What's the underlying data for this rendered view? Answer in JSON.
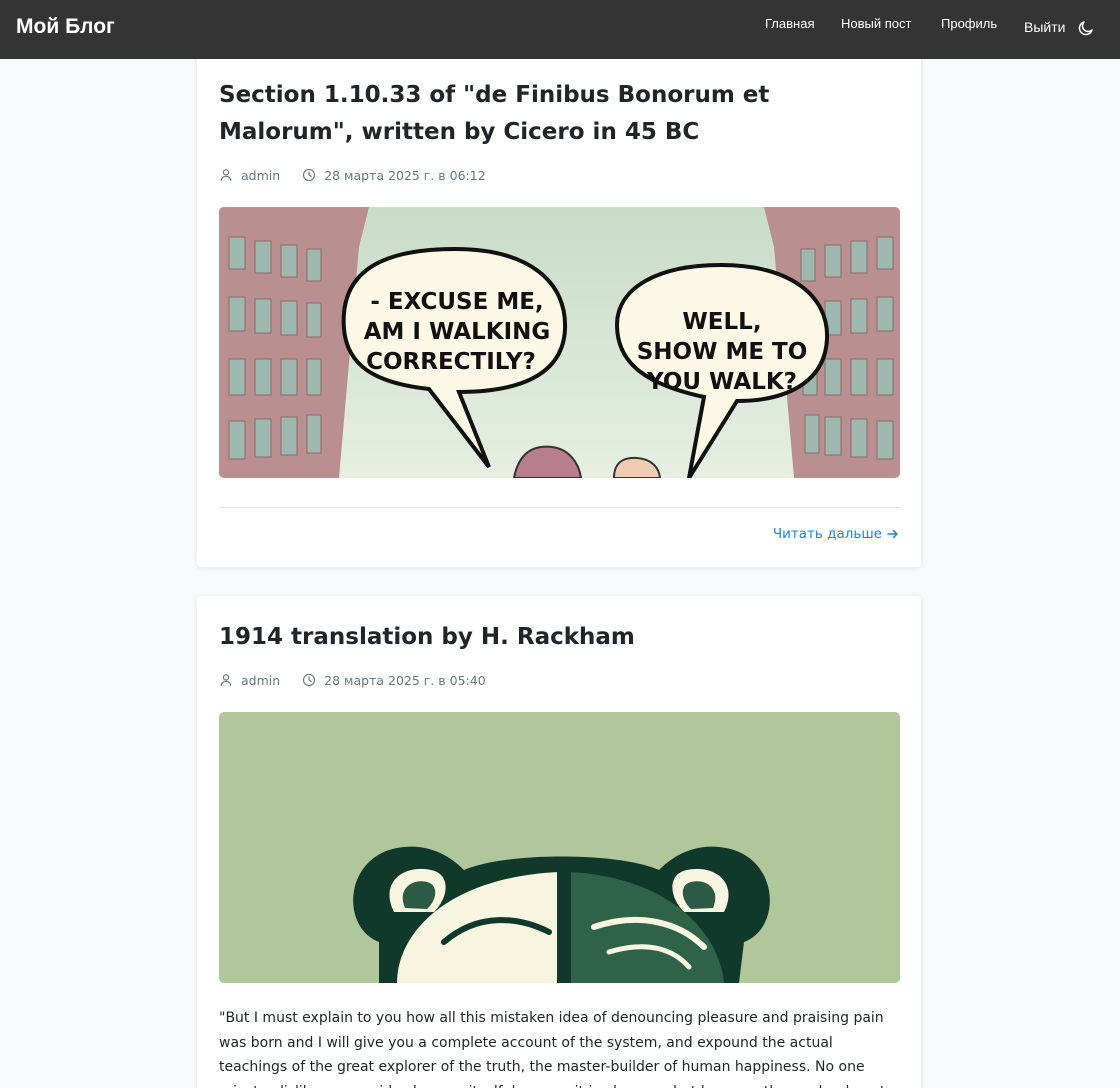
{
  "navbar": {
    "brand": "Мой Блог",
    "links": [
      "Главная",
      "Новый пост",
      "Профиль"
    ],
    "logout": "Выйти",
    "theme_icon": "moon-icon"
  },
  "posts": [
    {
      "title": "Section 1.10.33 of \"de Finibus Bonorum et Malorum\", written by Cicero in 45 BC",
      "author": "admin",
      "date": "28 марта 2025 г. в 06:12",
      "image": {
        "bubble_left": [
          "- EXCUSE ME,",
          "AM I WALKING",
          "CORRECTILY?"
        ],
        "bubble_right": [
          "WELL,",
          "SHOW ME TO",
          "YOU WALK?"
        ]
      },
      "read_more": "Читать дальше"
    },
    {
      "title": "1914 translation by H. Rackham",
      "author": "admin",
      "date": "28 марта 2025 г. в 05:40",
      "excerpt": "\"But I must explain to you how all this mistaken idea of denouncing pleasure and praising pain was born and I will give you a complete account of the system, and expound the actual teachings of the great explorer of the truth, the master-builder of human happiness. No one rejects, dislikes, or avoids pleasure itself, because it is pleasure, but because those who do not know how to pursue pleasure rationally encounter consequences that are extremely painful."
    }
  ],
  "colors": {
    "navbar_bg": "#343434",
    "link_accent": "#1a86d8",
    "page_bg": "#f8f9fa"
  }
}
